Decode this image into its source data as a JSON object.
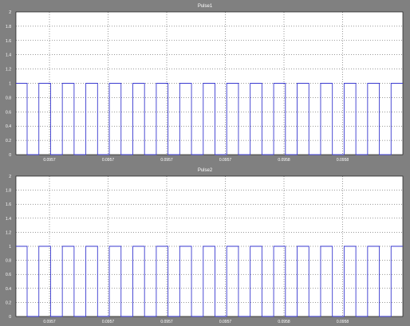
{
  "window": {
    "background": "#808080"
  },
  "chart_data": [
    {
      "type": "line",
      "title": "Pulse1",
      "line_color": "#3a3ad0",
      "axes_background": "#ffffff",
      "grid": true,
      "ylim": [
        0,
        2
      ],
      "yticks": [
        "0",
        "0.2",
        "0.4",
        "0.6",
        "0.8",
        "1",
        "1.2",
        "1.4",
        "1.6",
        "1.8",
        "2"
      ],
      "xticks": [
        "0.0957",
        "0.0957",
        "0.0957",
        "0.0957",
        "0.0958",
        "0.0958"
      ],
      "series": [
        {
          "values_pattern": "pulse train 0/1",
          "low": 0,
          "high": 1,
          "pulses": 16
        }
      ]
    },
    {
      "type": "line",
      "title": "Pulse2",
      "line_color": "#3a3ad0",
      "axes_background": "#ffffff",
      "grid": true,
      "ylim": [
        0,
        2
      ],
      "yticks": [
        "0",
        "0.2",
        "0.4",
        "0.6",
        "0.8",
        "1",
        "1.2",
        "1.4",
        "1.6",
        "1.8",
        "2"
      ],
      "xticks": [
        "0.0957",
        "0.0957",
        "0.0957",
        "0.0957",
        "0.0958",
        "0.0958"
      ],
      "series": [
        {
          "values_pattern": "pulse train 0/1",
          "low": 0,
          "high": 1,
          "pulses": 16
        }
      ]
    }
  ]
}
